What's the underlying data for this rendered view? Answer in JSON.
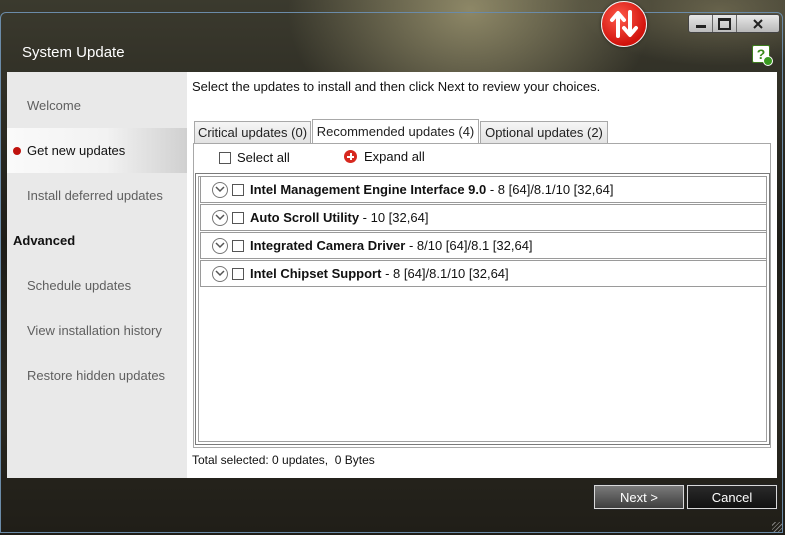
{
  "window": {
    "title": "System Update",
    "controls": {
      "minimize": "minimize",
      "maximize": "maximize",
      "close": "close"
    }
  },
  "sidebar": {
    "items": [
      {
        "label": "Welcome",
        "active": false
      },
      {
        "label": "Get new updates",
        "active": true
      },
      {
        "label": "Install deferred updates",
        "active": false
      }
    ],
    "advanced_heading": "Advanced",
    "advanced_items": [
      {
        "label": "Schedule updates"
      },
      {
        "label": "View installation history"
      },
      {
        "label": "Restore hidden updates"
      }
    ]
  },
  "main": {
    "instructions": "Select the updates to install and then click Next to review your choices.",
    "tabs": [
      {
        "label": "Critical updates (0)",
        "active": false
      },
      {
        "label": "Recommended updates (4)",
        "active": true
      },
      {
        "label": "Optional updates (2)",
        "active": false
      }
    ],
    "select_all_label": "Select all",
    "expand_all_label": "Expand all",
    "updates": [
      {
        "name": "Intel Management Engine Interface 9.0",
        "detail": " - 8 [64]/8.1/10 [32,64]",
        "checked": false
      },
      {
        "name": "Auto Scroll Utility",
        "detail": " - 10 [32,64]",
        "checked": false
      },
      {
        "name": "Integrated Camera Driver",
        "detail": " - 8/10 [64]/8.1 [32,64]",
        "checked": false
      },
      {
        "name": "Intel Chipset Support",
        "detail": " - 8 [64]/8.1/10 [32,64]",
        "checked": false
      }
    ],
    "status": "Total selected: 0 updates,  0 Bytes"
  },
  "footer": {
    "next_label": "Next >",
    "cancel_label": "Cancel"
  },
  "colors": {
    "accent_red": "#c0120d",
    "sidebar_bg": "#e9e9e9"
  },
  "icons": [
    "app-logo-icon",
    "help-icon",
    "expand-all-icon",
    "chevron-down-icon"
  ]
}
